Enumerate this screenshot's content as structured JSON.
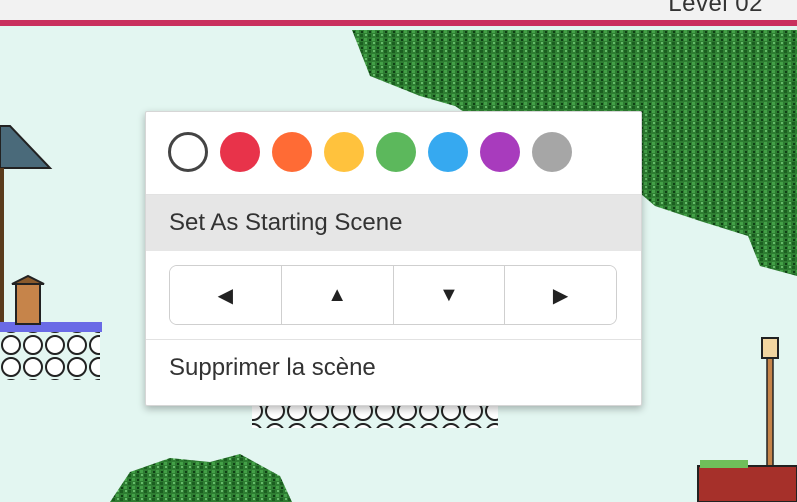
{
  "header": {
    "level_label": "Level 02"
  },
  "context_menu": {
    "colors": [
      {
        "name": "none",
        "hex": "#ffffff"
      },
      {
        "name": "red",
        "hex": "#e8334a"
      },
      {
        "name": "orange",
        "hex": "#ff6b35"
      },
      {
        "name": "yellow",
        "hex": "#ffc23d"
      },
      {
        "name": "green",
        "hex": "#5cb85c"
      },
      {
        "name": "blue",
        "hex": "#36a9f0"
      },
      {
        "name": "purple",
        "hex": "#a83bbd"
      },
      {
        "name": "gray",
        "hex": "#a6a6a6"
      }
    ],
    "starting_scene_label": "Set As Starting Scene",
    "arrows": {
      "left": "◀",
      "up": "▲",
      "down": "▼",
      "right": "▶"
    },
    "delete_label": "Supprimer la scène"
  },
  "theme": {
    "accent": "#c9305e",
    "sky": "#e3f6f1"
  }
}
